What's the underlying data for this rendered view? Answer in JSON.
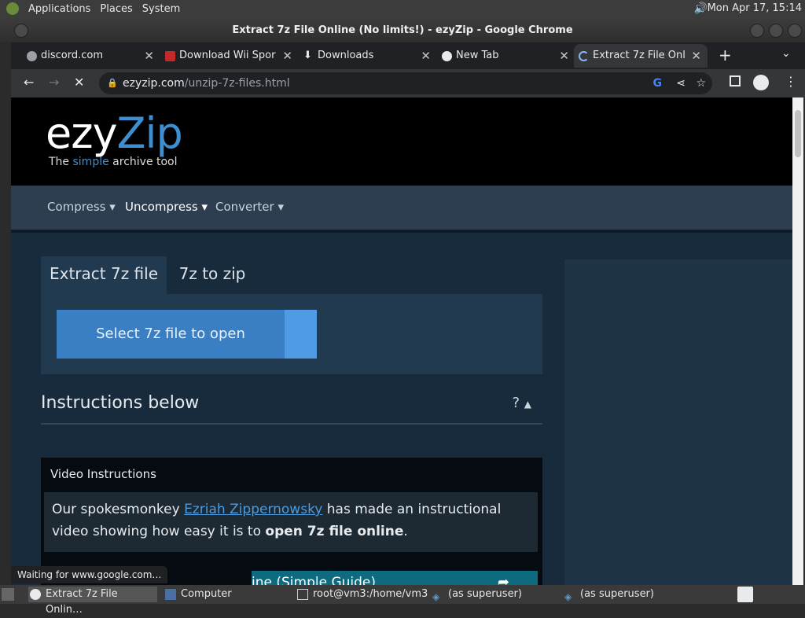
{
  "top_panel": {
    "menus": [
      "Applications",
      "Places",
      "System"
    ],
    "clock": "Mon Apr 17, 15:14"
  },
  "window": {
    "title": "Extract 7z File Online (No limits!) - ezyZip - Google Chrome"
  },
  "tabs": [
    {
      "label": "discord.com",
      "icon": "globe-icon"
    },
    {
      "label": "Download Wii Spor",
      "icon": "wii-icon"
    },
    {
      "label": "Downloads",
      "icon": "download-icon"
    },
    {
      "label": "New Tab",
      "icon": "chrome-icon"
    },
    {
      "label": "Extract 7z File Onl",
      "icon": "loading-icon"
    }
  ],
  "omnibox": {
    "host": "ezyzip.com",
    "path": "/unzip-7z-files.html"
  },
  "site": {
    "logo_ezy": "ezy",
    "logo_zip": "Zip",
    "tagline_pre": "The ",
    "tagline_simple": "simple",
    "tagline_post": " archive tool",
    "nav": [
      "Compress",
      "Uncompress",
      "Converter"
    ]
  },
  "main": {
    "tab_extract": "Extract 7z file",
    "tab_7z_zip": "7z to zip",
    "select_button": "Select 7z file to open",
    "instructions_heading": "Instructions below",
    "help_symbol": "?",
    "video_title": "Video Instructions",
    "video_text_1": "Our spokesmonkey ",
    "video_link": "Ezriah Zippernowsky",
    "video_text_2": " has made an instructional video showing how easy it is to ",
    "video_text_bold": "open 7z file online",
    "video_text_3": ".",
    "video_thumb_title": "ine (Simple Guide)"
  },
  "status_bar": "Waiting for www.google.com…",
  "taskbar": [
    {
      "label": "Extract 7z File Onlin…",
      "icon": "chrome-icon"
    },
    {
      "label": "Computer",
      "icon": "computer-icon"
    },
    {
      "label": "root@vm3:/home/vm3",
      "icon": "terminal-icon"
    },
    {
      "label": "(as superuser)",
      "icon": "fish-icon"
    },
    {
      "label": "(as superuser)",
      "icon": "fish-icon"
    }
  ],
  "colors": {
    "accent": "#3a7ec3",
    "link": "#4a9be0"
  }
}
